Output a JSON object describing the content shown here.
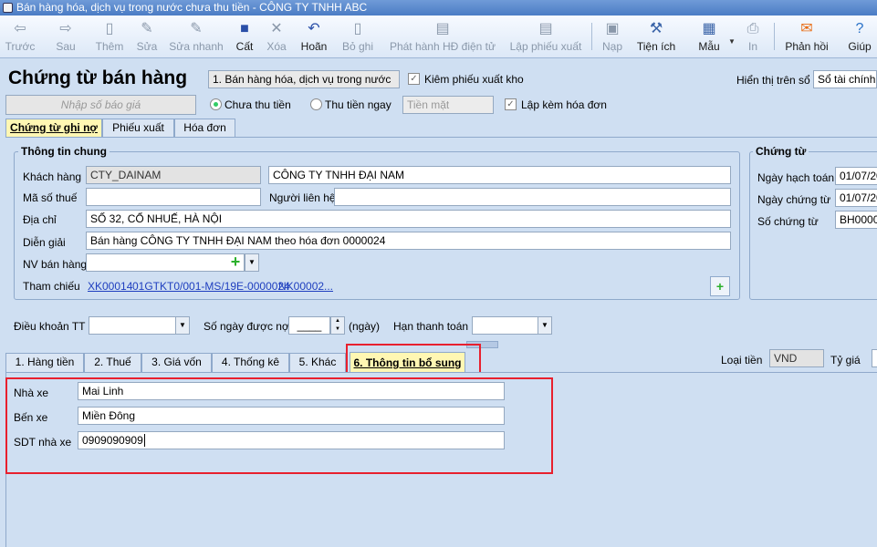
{
  "window": {
    "title": "Bán hàng hóa, dịch vụ trong nước chưa thu tiền - CÔNG TY TNHH ABC"
  },
  "toolbar": {
    "items": [
      {
        "label": "Trước",
        "icon": "arrow-left-icon"
      },
      {
        "label": "Sau",
        "icon": "arrow-right-icon"
      },
      {
        "label": "Thêm",
        "icon": "add-icon"
      },
      {
        "label": "Sửa",
        "icon": "edit-icon"
      },
      {
        "label": "Sửa nhanh",
        "icon": "quick-edit-icon"
      },
      {
        "label": "Cất",
        "icon": "save-icon"
      },
      {
        "label": "Xóa",
        "icon": "delete-icon"
      },
      {
        "label": "Hoãn",
        "icon": "undo-icon"
      },
      {
        "label": "Bỏ ghi",
        "icon": "unpost-icon"
      },
      {
        "label": "Phát hành HĐ điện tử",
        "icon": "einvoice-icon"
      },
      {
        "label": "Lập phiếu xuất",
        "icon": "issue-note-icon"
      },
      {
        "label": "Nạp",
        "icon": "reload-icon"
      },
      {
        "label": "Tiện ích",
        "icon": "utilities-icon"
      },
      {
        "label": "Mẫu",
        "icon": "template-icon"
      },
      {
        "label": "In",
        "icon": "print-icon"
      },
      {
        "label": "Phản hồi",
        "icon": "feedback-icon"
      },
      {
        "label": "Giúp",
        "icon": "help-icon"
      }
    ]
  },
  "header": {
    "title": "Chứng từ bán hàng",
    "type_select": "1. Bán hàng hóa, dịch vụ trong nước",
    "kiem_phieu_xuat_kho": "Kiêm phiếu xuất kho",
    "lap_kem_hoa_don": "Lập kèm hóa đơn",
    "hien_thi_label": "Hiển thị trên sổ",
    "hien_thi_value": "Sổ tài chính",
    "quote_placeholder": "Nhập số báo giá",
    "radio_unpaid": "Chưa thu tiền",
    "radio_paid": "Thu tiền ngay",
    "payment_method": "Tiền mặt"
  },
  "doc_tabs": [
    "Chứng từ ghi nợ",
    "Phiếu xuất",
    "Hóa đơn"
  ],
  "general_info": {
    "legend": "Thông tin chung",
    "customer_label": "Khách hàng",
    "customer_code": "CTY_DAINAM",
    "customer_name": "CÔNG TY TNHH ĐẠI NAM",
    "tax_label": "Mã số thuế",
    "tax_value": "",
    "contact_label": "Người liên hệ",
    "contact_value": "",
    "address_label": "Địa chỉ",
    "address_value": "SỐ 32, CỔ NHUẾ, HÀ NỘI",
    "desc_label": "Diễn giải",
    "desc_value": "Bán hàng CÔNG TY TNHH ĐẠI NAM theo hóa đơn 0000024",
    "sales_label": "NV bán hàng",
    "sales_value": "",
    "ref_label": "Tham chiếu",
    "refs": [
      "XK00014",
      "01GTKT0/001-MS/19E-0000024",
      "NK00002",
      "..."
    ]
  },
  "voucher": {
    "legend": "Chứng từ",
    "posting_date_label": "Ngày hạch toán",
    "posting_date": "01/07/20",
    "doc_date_label": "Ngày chứng từ",
    "doc_date": "01/07/20",
    "doc_no_label": "Số chứng từ",
    "doc_no": "BH0000"
  },
  "terms": {
    "dieu_khoan_label": "Điều khoản TT",
    "so_ngay_label": "Số ngày được nợ",
    "so_ngay_value": "____",
    "ngay_unit": "(ngày)",
    "han_tt_label": "Hạn thanh toán"
  },
  "detail_tabs": [
    "1. Hàng tiền",
    "2. Thuế",
    "3. Giá vốn",
    "4. Thống kê",
    "5. Khác",
    "6. Thông tin bổ sung"
  ],
  "currency": {
    "label": "Loại tiền",
    "value": "VND",
    "rate_label": "Tỷ giá"
  },
  "extra": {
    "nha_xe_label": "Nhà xe",
    "nha_xe": "Mai Linh",
    "ben_xe_label": "Bến xe",
    "ben_xe": "Miền Đông",
    "sdt_label": "SDT nhà xe",
    "sdt": "0909090909"
  },
  "colors": {
    "highlight": "#e8202e",
    "active_tab": "#fff7b3",
    "background": "#cfdff2"
  }
}
